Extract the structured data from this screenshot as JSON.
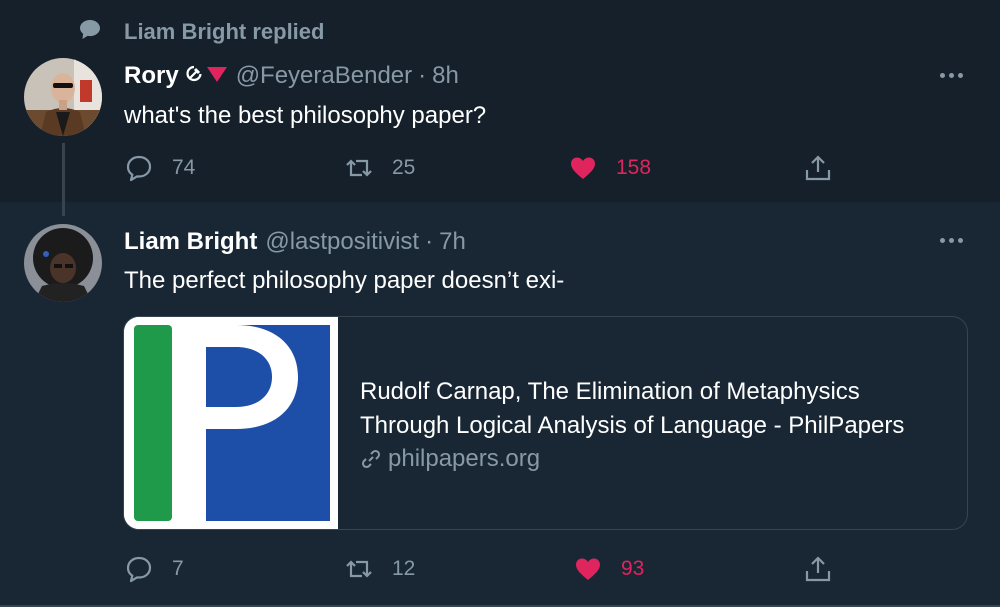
{
  "context": {
    "text": "Liam Bright replied",
    "icon": "speech-bubble-icon"
  },
  "tweets": [
    {
      "display_name": "Rory",
      "emojis": [
        "hammer-and-sickle-icon",
        "red-triangle-icon"
      ],
      "handle": "@FeyeraBender",
      "separator": "·",
      "time": "8h",
      "text": "what's the best philosophy paper?",
      "actions": {
        "reply": "74",
        "retweet": "25",
        "like": "158"
      },
      "liked": true
    },
    {
      "display_name": "Liam Bright",
      "handle": "@lastpositivist",
      "separator": "·",
      "time": "7h",
      "text": "The perfect philosophy paper doesn’t exi-",
      "card": {
        "title_line1": "Rudolf Carnap, The Elimination of Metaphysics",
        "title_line2": "Through Logical Analysis of Language - PhilPapers",
        "domain": "philpapers.org",
        "logo": "philpapers-logo"
      },
      "actions": {
        "reply": "7",
        "retweet": "12",
        "like": "93"
      },
      "liked": true
    }
  ],
  "colors": {
    "background": "#15202b",
    "highlight_background": "#192734",
    "text": "#ffffff",
    "secondary_text": "#8899a6",
    "like": "#e0245e",
    "border": "#38444d",
    "philpapers_blue": "#1d4fa8",
    "philpapers_green": "#1f9a4a"
  }
}
